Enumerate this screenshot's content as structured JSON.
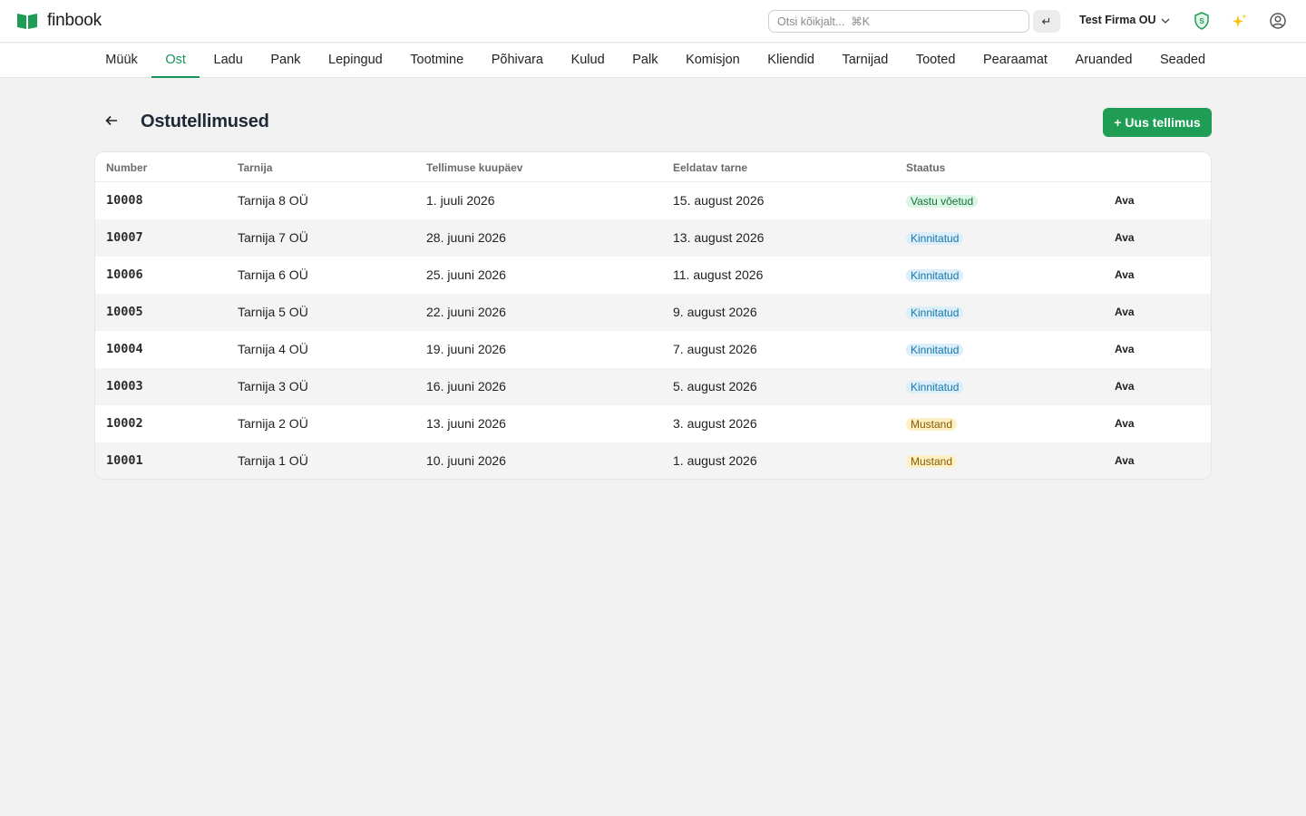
{
  "app": {
    "name": "finbook"
  },
  "search": {
    "placeholder": "Otsi kõikjalt...  ⌘K",
    "value": ""
  },
  "enter_icon": "enter-icon",
  "company": {
    "name": "Test Firma OU"
  },
  "nav": {
    "items": [
      {
        "label": "Müük",
        "active": false
      },
      {
        "label": "Ost",
        "active": true
      },
      {
        "label": "Ladu",
        "active": false
      },
      {
        "label": "Pank",
        "active": false
      },
      {
        "label": "Lepingud",
        "active": false
      },
      {
        "label": "Tootmine",
        "active": false
      },
      {
        "label": "Põhivara",
        "active": false
      },
      {
        "label": "Kulud",
        "active": false
      },
      {
        "label": "Palk",
        "active": false
      },
      {
        "label": "Komisjon",
        "active": false
      },
      {
        "label": "Kliendid",
        "active": false
      },
      {
        "label": "Tarnijad",
        "active": false
      },
      {
        "label": "Tooted",
        "active": false
      },
      {
        "label": "Pearaamat",
        "active": false
      },
      {
        "label": "Aruanded",
        "active": false
      },
      {
        "label": "Seaded",
        "active": false
      }
    ]
  },
  "page": {
    "title": "Ostutellimused",
    "new_button": "+ Uus tellimus"
  },
  "table": {
    "columns": [
      "Number",
      "Tarnija",
      "Tellimuse kuupäev",
      "Eeldatav tarne",
      "Staatus"
    ],
    "rows": [
      {
        "number": "10008",
        "supplier": "Tarnija 8 OÜ",
        "order_date": "1. juuli 2026",
        "delivery": "15. august 2026",
        "status": "Vastu võetud",
        "status_kind": "received",
        "action": "Ava"
      },
      {
        "number": "10007",
        "supplier": "Tarnija 7 OÜ",
        "order_date": "28. juuni 2026",
        "delivery": "13. august 2026",
        "status": "Kinnitatud",
        "status_kind": "confirmed",
        "action": "Ava"
      },
      {
        "number": "10006",
        "supplier": "Tarnija 6 OÜ",
        "order_date": "25. juuni 2026",
        "delivery": "11. august 2026",
        "status": "Kinnitatud",
        "status_kind": "confirmed",
        "action": "Ava"
      },
      {
        "number": "10005",
        "supplier": "Tarnija 5 OÜ",
        "order_date": "22. juuni 2026",
        "delivery": "9. august 2026",
        "status": "Kinnitatud",
        "status_kind": "confirmed",
        "action": "Ava"
      },
      {
        "number": "10004",
        "supplier": "Tarnija 4 OÜ",
        "order_date": "19. juuni 2026",
        "delivery": "7. august 2026",
        "status": "Kinnitatud",
        "status_kind": "confirmed",
        "action": "Ava"
      },
      {
        "number": "10003",
        "supplier": "Tarnija 3 OÜ",
        "order_date": "16. juuni 2026",
        "delivery": "5. august 2026",
        "status": "Kinnitatud",
        "status_kind": "confirmed",
        "action": "Ava"
      },
      {
        "number": "10002",
        "supplier": "Tarnija 2 OÜ",
        "order_date": "13. juuni 2026",
        "delivery": "3. august 2026",
        "status": "Mustand",
        "status_kind": "draft",
        "action": "Ava"
      },
      {
        "number": "10001",
        "supplier": "Tarnija 1 OÜ",
        "order_date": "10. juuni 2026",
        "delivery": "1. august 2026",
        "status": "Mustand",
        "status_kind": "draft",
        "action": "Ava"
      }
    ]
  },
  "status_colors": {
    "received": {
      "bg": "#dcf5e4",
      "fg": "#16733d"
    },
    "confirmed": {
      "bg": "#dbeefa",
      "fg": "#1777a8"
    },
    "draft": {
      "bg": "#fdf0c4",
      "fg": "#8a5a00"
    }
  },
  "colors": {
    "accent": "#17945a",
    "primary_button": "#1f9d55"
  },
  "icons": {
    "logo": "book-icon",
    "security": "shield-icon",
    "ai": "sparkles-icon",
    "account": "user-circle-icon",
    "back": "arrow-left-icon",
    "company_menu": "chevron-down-icon"
  }
}
